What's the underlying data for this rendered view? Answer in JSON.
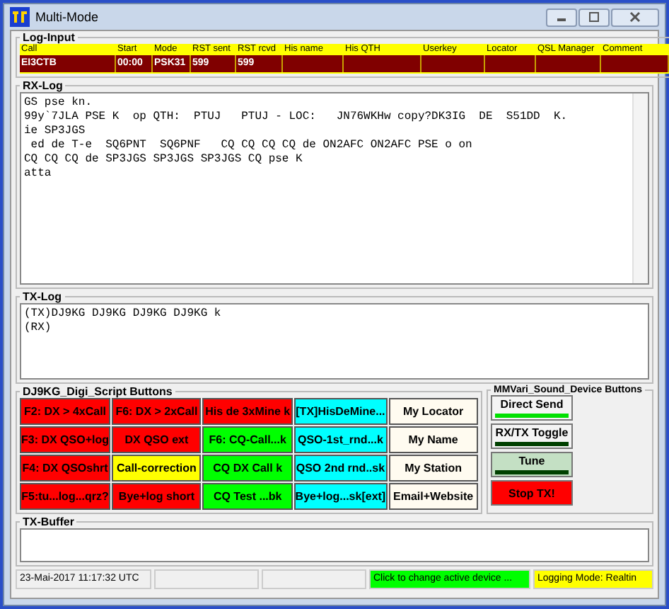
{
  "window": {
    "title": "Multi-Mode"
  },
  "log_input": {
    "title": "Log-Input",
    "columns": [
      "Call",
      "Start",
      "Mode",
      "RST sent",
      "RST rcvd",
      "His name",
      "His QTH",
      "Userkey",
      "Locator",
      "QSL Manager",
      "Comment"
    ],
    "row": [
      "EI3CTB",
      "00:00",
      "PSK31",
      "599",
      "599"
    ]
  },
  "rx_log": {
    "title": "RX-Log",
    "lines": [
      "GS pse kn.",
      "99y`7JLA PSE K  op QTH:  PTUJ   PTUJ - LOC:   JN76WKHw copy?DK3IG  DE  S51DD  K.",
      "ie SP3JGS",
      " ed de T-e  SQ6PNT  SQ6PNF   CQ CQ CQ CQ de ON2AFC ON2AFC PSE o on",
      "CQ CQ CQ de SP3JGS SP3JGS SP3JGS CQ pse K",
      "atta"
    ]
  },
  "tx_log": {
    "title": "TX-Log",
    "lines": [
      "(TX)DJ9KG DJ9KG DJ9KG DJ9KG k",
      "(RX)"
    ]
  },
  "script_buttons": {
    "title": "DJ9KG_Digi_Script Buttons",
    "buttons": [
      {
        "label": "F2: DX > 4xCall",
        "color": "#ff0000"
      },
      {
        "label": "F6: DX > 2xCall",
        "color": "#ff0000"
      },
      {
        "label": "His de 3xMine k",
        "color": "#ff0000"
      },
      {
        "label": "[TX]HisDeMine...",
        "color": "#00ffff"
      },
      {
        "label": "My Locator",
        "color": "#fffbf0"
      },
      {
        "label": "F3: DX QSO+log",
        "color": "#ff0000"
      },
      {
        "label": "DX QSO ext",
        "color": "#ff0000"
      },
      {
        "label": "F6: CQ-Call...k",
        "color": "#00ff00"
      },
      {
        "label": "QSO-1st_rnd...k",
        "color": "#00ffff"
      },
      {
        "label": "My Name",
        "color": "#fffbf0"
      },
      {
        "label": "F4: DX QSOshrt",
        "color": "#ff0000"
      },
      {
        "label": "Call-correction",
        "color": "#ffff00"
      },
      {
        "label": "CQ DX Call k",
        "color": "#00ff00"
      },
      {
        "label": "QSO 2nd rnd..sk",
        "color": "#00ffff"
      },
      {
        "label": "My Station",
        "color": "#fffbf0"
      },
      {
        "label": "F5:tu...log...qrz?",
        "color": "#ff0000"
      },
      {
        "label": "Bye+log short",
        "color": "#ff0000"
      },
      {
        "label": "CQ Test ...bk",
        "color": "#00ff00"
      },
      {
        "label": "Bye+log...sk[ext]",
        "color": "#00ffff"
      },
      {
        "label": "Email+Website",
        "color": "#fffbf0"
      }
    ]
  },
  "sound_buttons": {
    "title": "MMVari_Sound_Device Buttons",
    "buttons": [
      {
        "label": "Direct Send",
        "kind": "indicator",
        "color": "#f4f4f4",
        "on": true
      },
      {
        "label": "RX/TX Toggle",
        "kind": "indicator",
        "color": "#f4f4f4",
        "on": false
      },
      {
        "label": "Tune",
        "kind": "indicator",
        "color": "#c4e0c4",
        "on": false
      },
      {
        "label": "Stop TX!",
        "kind": "plain",
        "color": "#ff0000"
      }
    ]
  },
  "tx_buffer": {
    "title": "TX-Buffer"
  },
  "status_bar": [
    {
      "text": "23-Mai-2017  11:17:32 UTC",
      "color": "#f0f0f0"
    },
    {
      "color": "#f0f0f0"
    },
    {
      "color": "#f0f0f0"
    },
    {
      "text": "Click to change active device ...",
      "color": "#00ff00"
    },
    {
      "text": "Logging Mode: Realtin",
      "color": "#ffff00"
    }
  ]
}
